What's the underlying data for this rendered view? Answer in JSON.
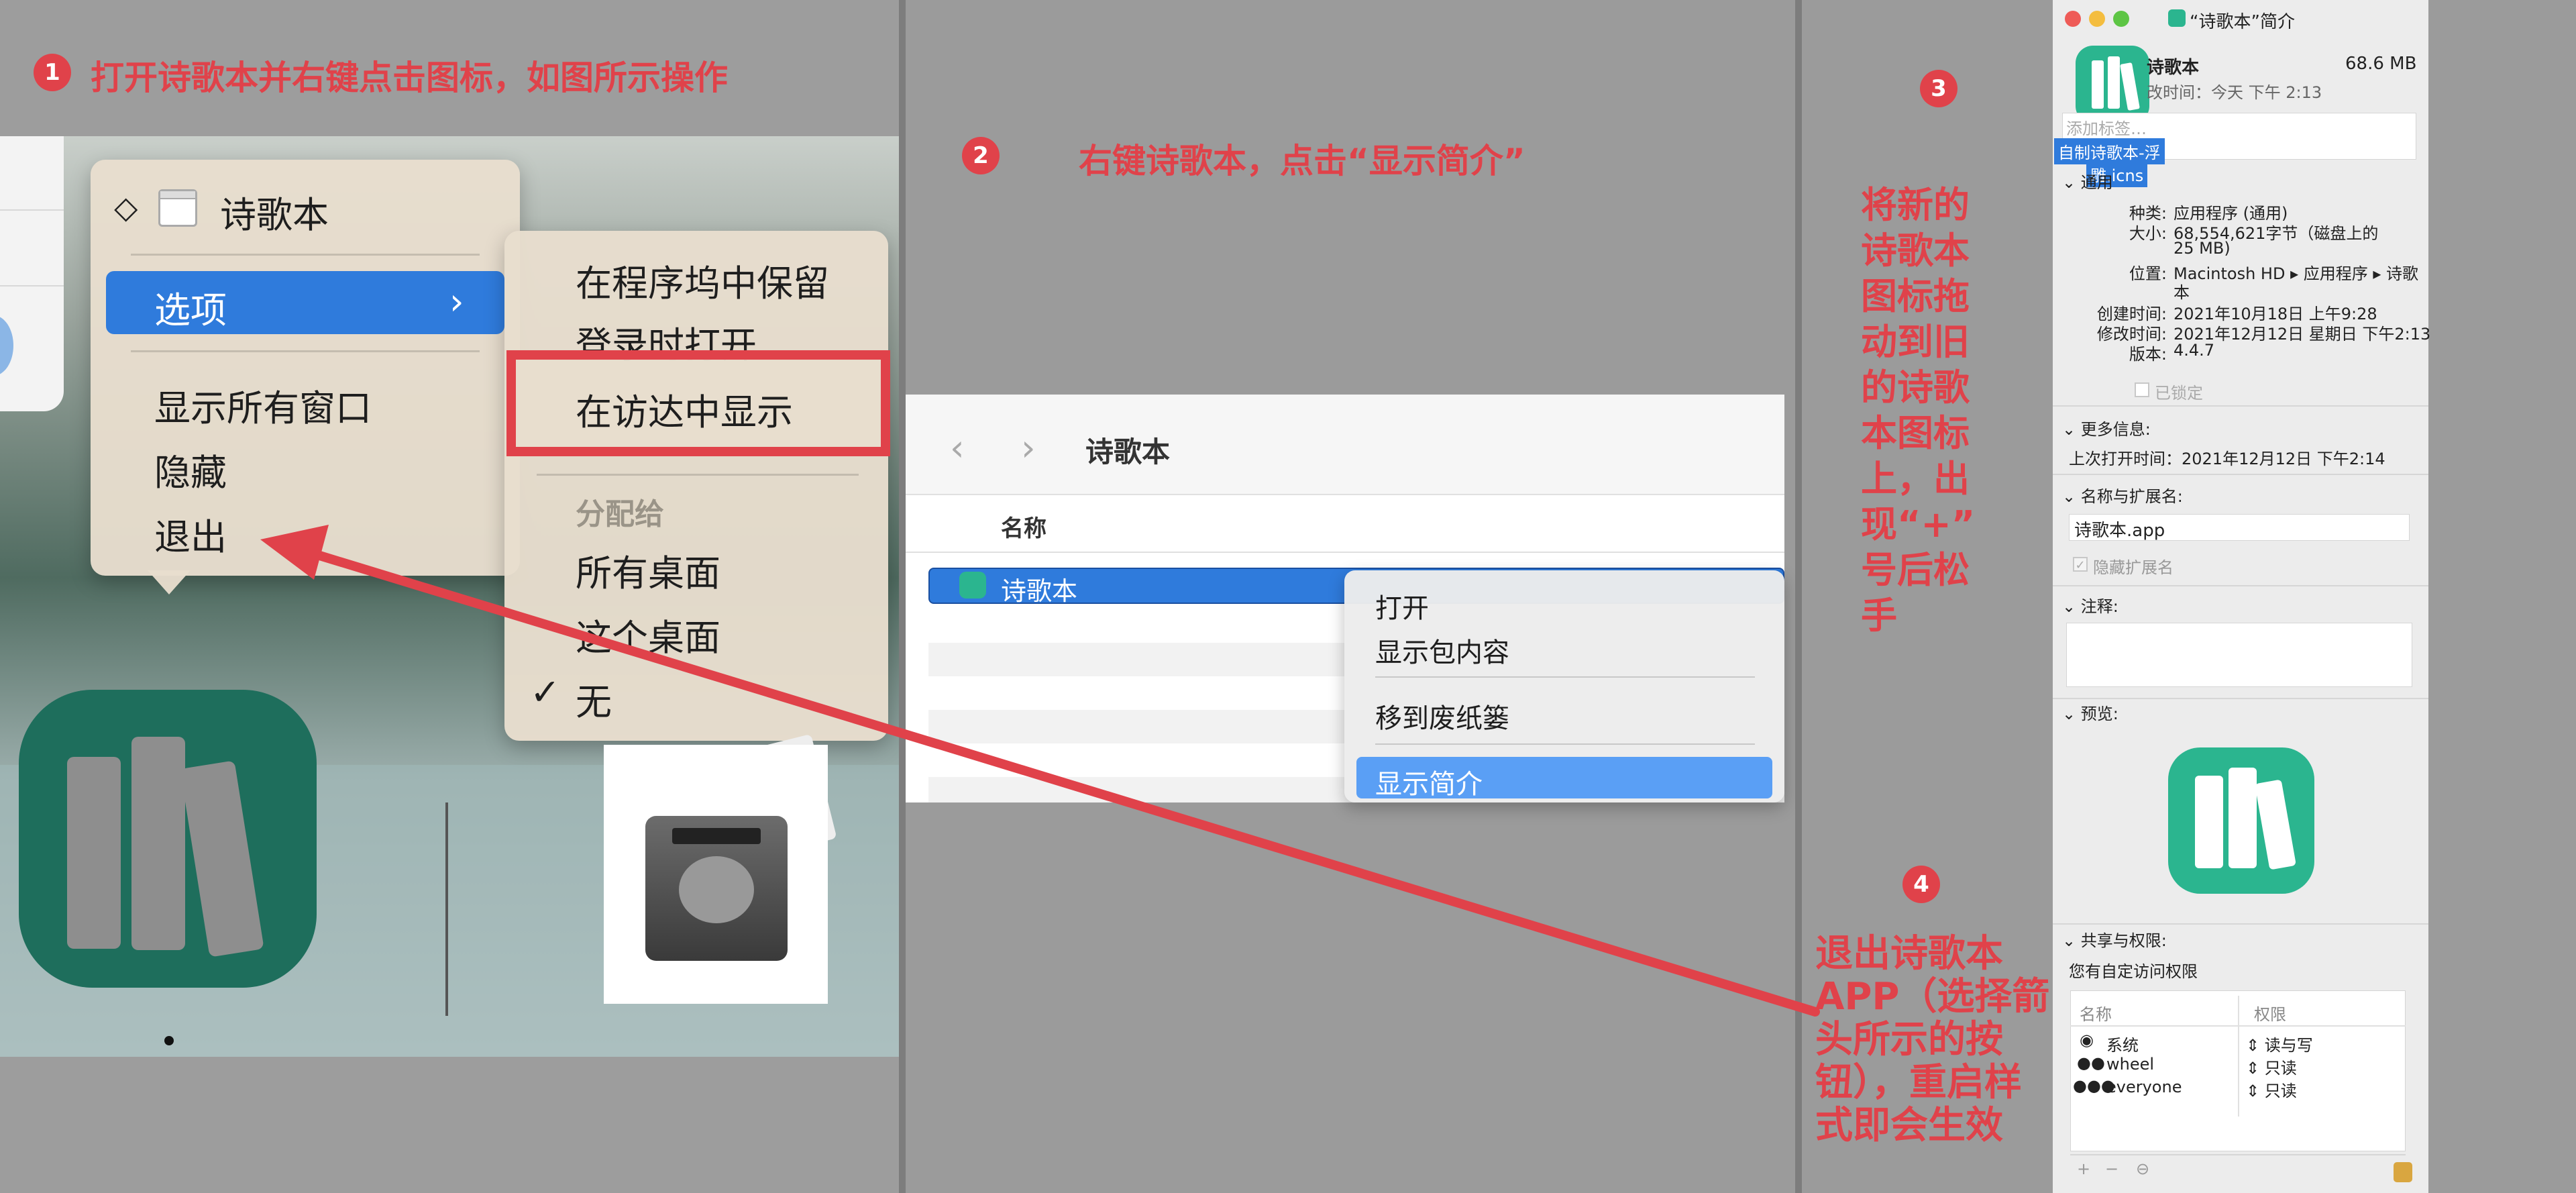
{
  "colors": {
    "accent_red": "#e0424a",
    "selection_blue": "#2f7bdc",
    "app_green": "#1e6e5c",
    "preview_green": "#2bb58f"
  },
  "steps": [
    {
      "num": "1",
      "text": "打开诗歌本并右键点击图标，如图所示操作"
    },
    {
      "num": "2",
      "text": "右键诗歌本，点击“显示简介”"
    },
    {
      "num": "3",
      "text": "将新的诗歌本图标拖动到旧的诗歌本图标上，出现“+”号后松手"
    },
    {
      "num": "4",
      "text": "退出诗歌本APP（选择箭头所示的按钮），重启样式即会生效"
    }
  ],
  "step3_lines": [
    "将新的",
    "诗歌本",
    "图标拖",
    "动到旧",
    "的诗歌",
    "本图标",
    "上，出",
    "现“+”",
    "号后松",
    "手"
  ],
  "step4_lines": [
    "退出诗歌本",
    "APP（选择箭",
    "头所示的按",
    "钮），重启样",
    "式即会生效"
  ],
  "dock_menu": {
    "app_name": "诗歌本",
    "selected": "选项",
    "items": [
      "显示所有窗口",
      "隐藏",
      "退出"
    ]
  },
  "options_submenu": {
    "items_top": [
      "在程序坞中保留",
      "登录时打开",
      "在访达中显示"
    ],
    "header": "分配给",
    "items_assign": [
      "所有桌面",
      "这个桌面",
      "无"
    ],
    "checkmark": "✓"
  },
  "finder": {
    "title": "诗歌本",
    "column_name": "名称",
    "row_name": "诗歌本",
    "context_menu": [
      "打开",
      "显示包内容",
      "移到废纸篓",
      "显示简介"
    ]
  },
  "info_window": {
    "title": "“诗歌本”简介",
    "app_name": "诗歌本",
    "size": "68.6 MB",
    "modified_short": "改时间：今天 下午 2:13",
    "tags_placeholder": "添加标签…",
    "drag_filename_1": "自制诗歌本-浮",
    "drag_filename_2": "雕.icns",
    "general_header": "通用",
    "general": [
      {
        "label": "种类:",
        "value": "应用程序 (通用)"
      },
      {
        "label": "大小:",
        "value": "68,554,621字节（磁盘上的"
      },
      {
        "label": "",
        "value": "25 MB)"
      },
      {
        "label": "位置:",
        "value": "Macintosh HD ▸ 应用程序 ▸ 诗歌"
      },
      {
        "label": "",
        "value": "本"
      },
      {
        "label": "创建时间:",
        "value": "2021年10月18日 上午9:28"
      },
      {
        "label": "修改时间:",
        "value": "2021年12月12日 星期日 下午2:13"
      },
      {
        "label": "版本:",
        "value": "4.4.7"
      }
    ],
    "locked": "已锁定",
    "more_info_header": "更多信息:",
    "last_opened": "上次打开时间：2021年12月12日 下午2:14",
    "name_ext_header": "名称与扩展名:",
    "name_value": "诗歌本.app",
    "hide_ext": "隐藏扩展名",
    "comments_header": "注释:",
    "preview_header": "预览:",
    "sharing_header": "共享与权限:",
    "custom_access": "您有自定访问权限",
    "perm_col_name": "名称",
    "perm_col_priv": "权限",
    "permissions": [
      {
        "name": "系统",
        "priv": "读与写"
      },
      {
        "name": "wheel",
        "priv": "只读"
      },
      {
        "name": "everyone",
        "priv": "只读"
      }
    ],
    "footer_buttons": [
      "+",
      "−",
      "⊖"
    ]
  }
}
